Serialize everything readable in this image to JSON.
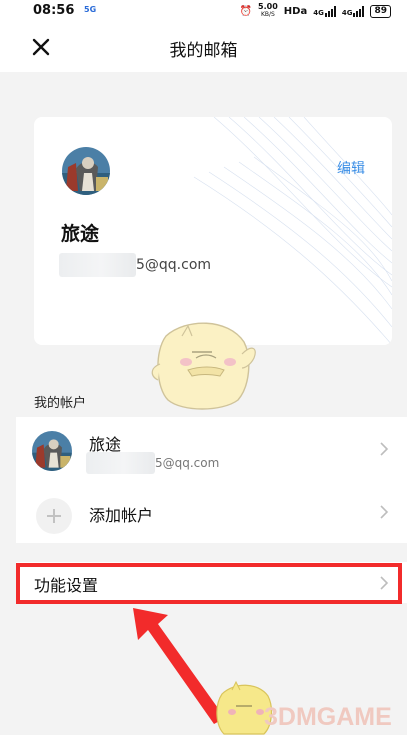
{
  "status_bar": {
    "time": "08:56",
    "network_badge": "5G",
    "speed": "5.00",
    "speed_unit": "KB/S",
    "hd": "HDa",
    "net1": "4G",
    "net2": "4G",
    "battery": "89"
  },
  "header": {
    "title": "我的邮箱",
    "close_icon": "close-icon"
  },
  "profile": {
    "edit_label": "编辑",
    "name": "旅途",
    "email_suffix": "5@qq.com"
  },
  "accounts_section": {
    "label": "我的帐户",
    "items": [
      {
        "name": "旅途",
        "email_suffix": "5@qq.com"
      }
    ],
    "add_label": "添加帐户"
  },
  "features": {
    "label": "功能设置"
  },
  "watermark": {
    "text": "3DMGAME"
  },
  "colors": {
    "accent": "#3a8ee6",
    "highlight": "#f22b2b",
    "background": "#f3f3f3"
  }
}
